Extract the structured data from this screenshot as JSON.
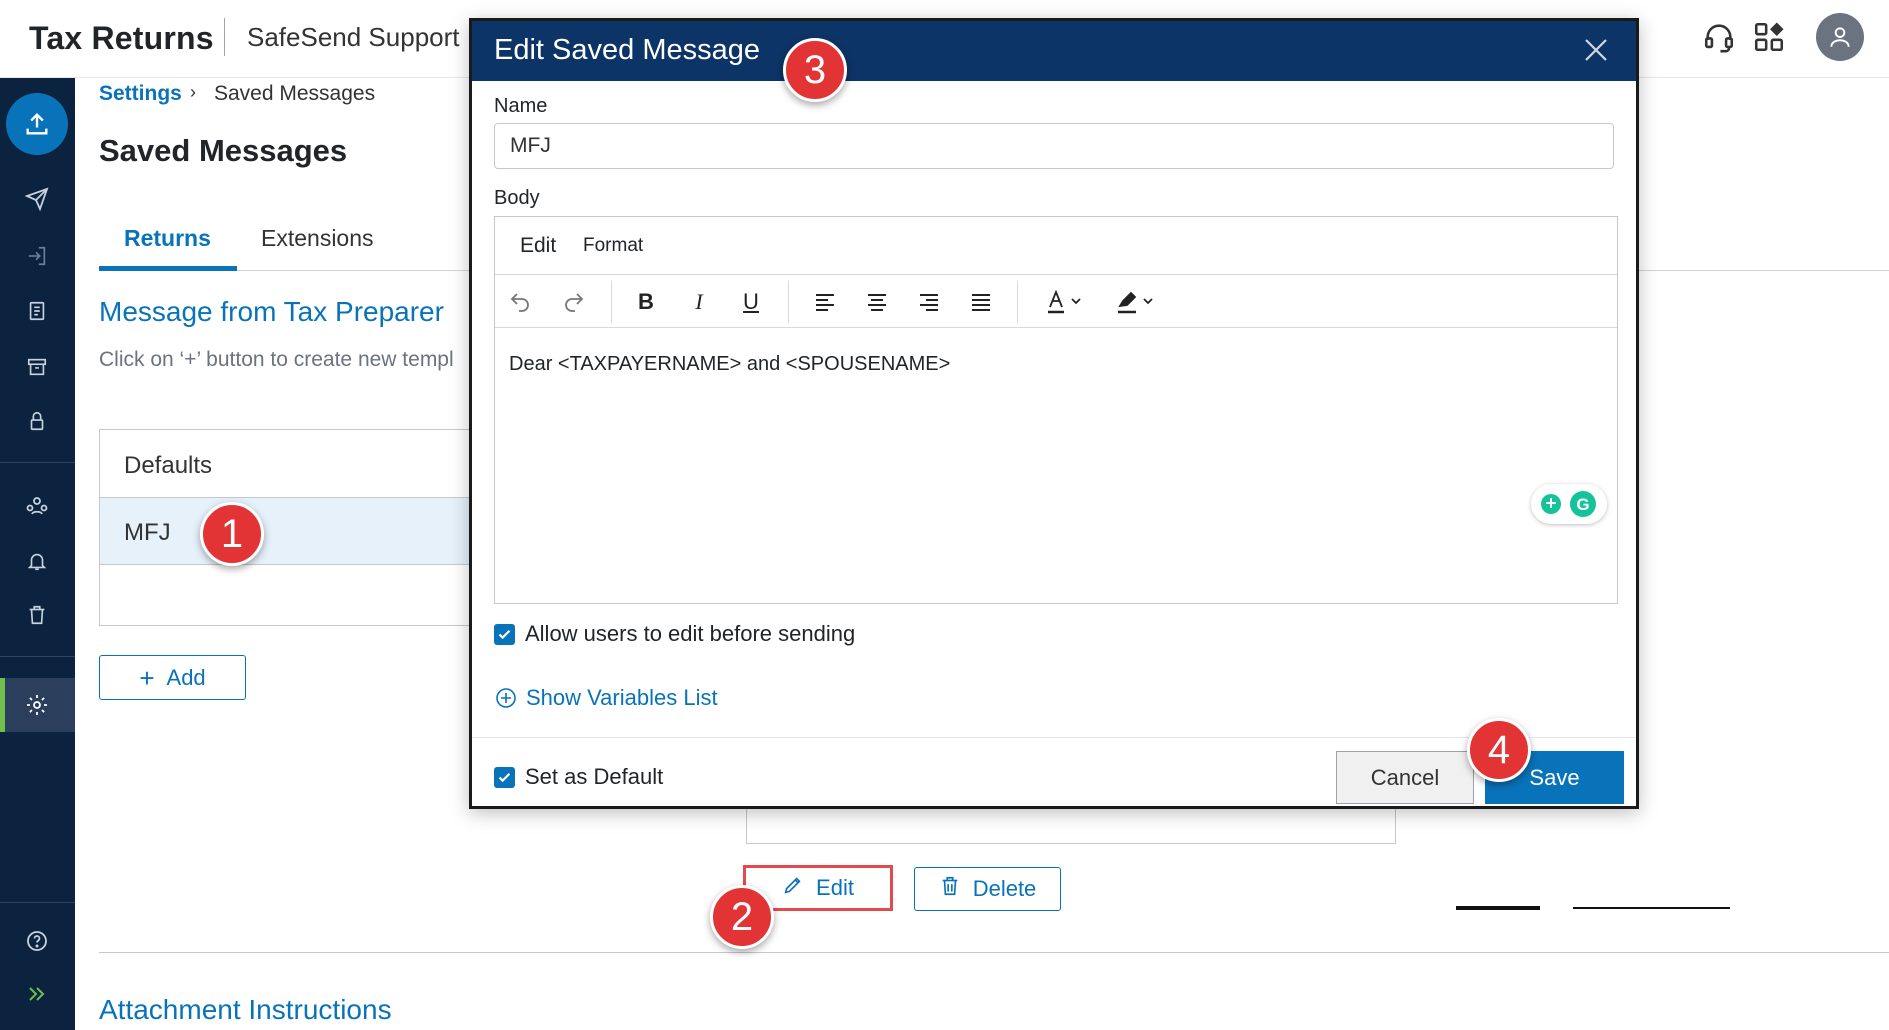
{
  "header": {
    "brand": "Tax Returns",
    "company": "SafeSend Support"
  },
  "breadcrumb": {
    "parent": "Settings",
    "separator": "›",
    "current": "Saved Messages"
  },
  "page": {
    "title": "Saved Messages",
    "tabs": [
      {
        "label": "Returns",
        "active": true
      },
      {
        "label": "Extensions",
        "active": false
      }
    ],
    "section_title": "Message from Tax Preparer",
    "hint": "Click on ‘+’ button to create new templ",
    "list": {
      "header": "Defaults",
      "items": [
        "MFJ"
      ]
    },
    "add_label": "Add",
    "edit_label": "Edit",
    "delete_label": "Delete",
    "attachment_title": "Attachment Instructions"
  },
  "modal": {
    "title": "Edit Saved Message",
    "name_label": "Name",
    "name_value": "MFJ",
    "body_label": "Body",
    "menu": [
      "Edit",
      "Format"
    ],
    "toolbar_icons": [
      "undo-icon",
      "redo-icon",
      "bold-icon",
      "italic-icon",
      "underline-icon",
      "align-left-icon",
      "align-center-icon",
      "align-right-icon",
      "justify-icon",
      "font-color-icon",
      "highlight-icon"
    ],
    "body_text": "Dear <TAXPAYERNAME> and <SPOUSENAME>",
    "allow_edit_label": "Allow users to edit before sending",
    "allow_edit_checked": true,
    "variables_link": "Show Variables List",
    "default_label": "Set as Default",
    "default_checked": true,
    "cancel_label": "Cancel",
    "save_label": "Save"
  },
  "badges": [
    "1",
    "2",
    "3",
    "4"
  ],
  "colors": {
    "accent": "#0973ba",
    "sidebar": "#0c2340",
    "modal_header": "#0c3466",
    "badge": "#e23434",
    "active_indicator": "#6fbf4a"
  }
}
